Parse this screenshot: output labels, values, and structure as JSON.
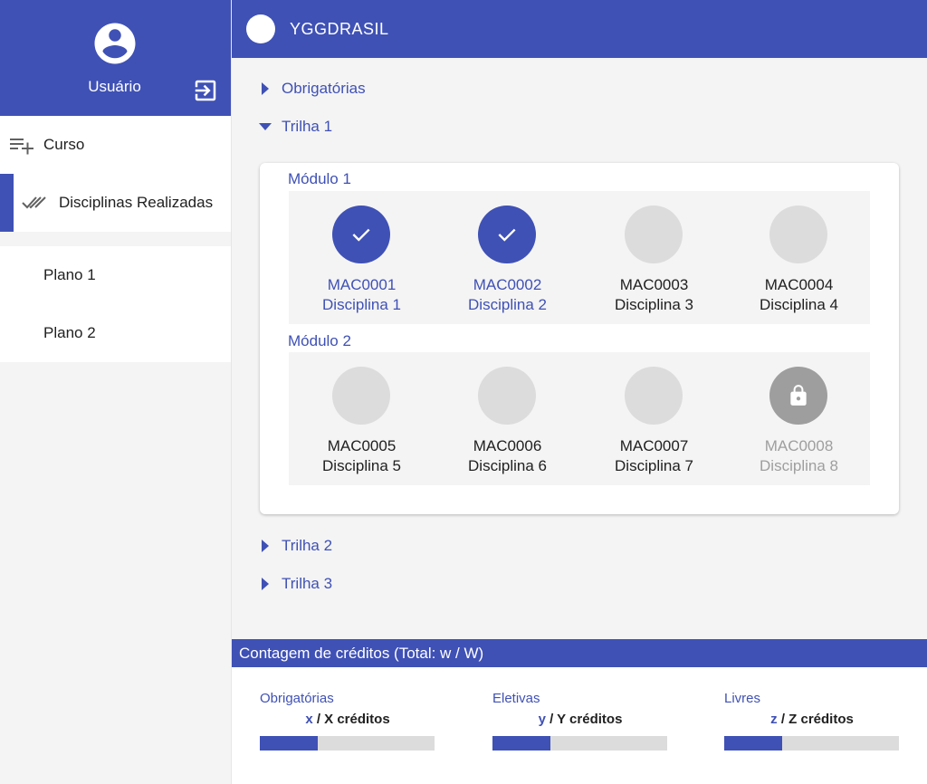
{
  "app": {
    "title": "YGGDRASIL"
  },
  "sidebar": {
    "user_name": "Usuário",
    "nav": [
      {
        "label": "Curso",
        "icon": "playlist-add-icon"
      },
      {
        "label": "Disciplinas Realizadas",
        "icon": "done-all-icon",
        "active": true
      }
    ],
    "plans": [
      {
        "label": "Plano 1"
      },
      {
        "label": "Plano 2"
      }
    ]
  },
  "tree": {
    "obrigatorias": "Obrigatórias",
    "trilha1": "Trilha 1",
    "trilha2": "Trilha 2",
    "trilha3": "Trilha 3"
  },
  "modules": [
    {
      "title": "Módulo 1",
      "disciplines": [
        {
          "code": "MAC0001",
          "name": "Disciplina 1",
          "status": "done"
        },
        {
          "code": "MAC0002",
          "name": "Disciplina 2",
          "status": "done"
        },
        {
          "code": "MAC0003",
          "name": "Disciplina 3",
          "status": "available"
        },
        {
          "code": "MAC0004",
          "name": "Disciplina 4",
          "status": "available"
        }
      ]
    },
    {
      "title": "Módulo 2",
      "disciplines": [
        {
          "code": "MAC0005",
          "name": "Disciplina 5",
          "status": "available"
        },
        {
          "code": "MAC0006",
          "name": "Disciplina 6",
          "status": "available"
        },
        {
          "code": "MAC0007",
          "name": "Disciplina 7",
          "status": "available"
        },
        {
          "code": "MAC0008",
          "name": "Disciplina 8",
          "status": "locked"
        }
      ]
    }
  ],
  "credits": {
    "header": "Contagem de créditos (Total: w / W)",
    "items": [
      {
        "label": "Obrigatórias",
        "value": "x",
        "rest": " / X créditos",
        "progress": 0.33
      },
      {
        "label": "Eletivas",
        "value": "y",
        "rest": " / Y créditos",
        "progress": 0.33
      },
      {
        "label": "Livres",
        "value": "z",
        "rest": " / Z créditos",
        "progress": 0.33
      }
    ]
  },
  "colors": {
    "primary": "#3f51b5",
    "inactive": "#dcdcdc",
    "locked": "#9e9e9e"
  }
}
